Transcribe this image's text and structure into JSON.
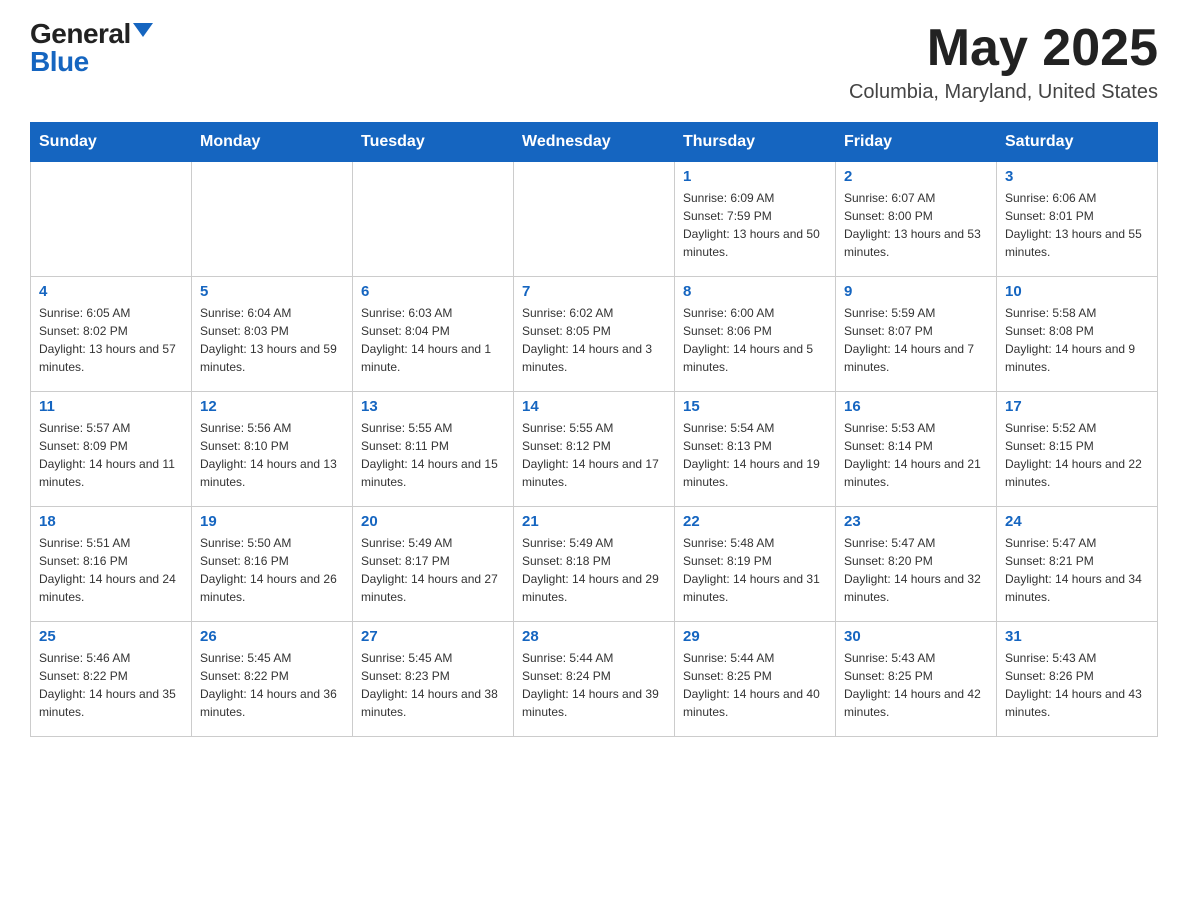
{
  "header": {
    "logo_general": "General",
    "logo_blue": "Blue",
    "month": "May 2025",
    "location": "Columbia, Maryland, United States"
  },
  "weekdays": [
    "Sunday",
    "Monday",
    "Tuesday",
    "Wednesday",
    "Thursday",
    "Friday",
    "Saturday"
  ],
  "weeks": [
    [
      {
        "day": "",
        "info": ""
      },
      {
        "day": "",
        "info": ""
      },
      {
        "day": "",
        "info": ""
      },
      {
        "day": "",
        "info": ""
      },
      {
        "day": "1",
        "info": "Sunrise: 6:09 AM\nSunset: 7:59 PM\nDaylight: 13 hours and 50 minutes."
      },
      {
        "day": "2",
        "info": "Sunrise: 6:07 AM\nSunset: 8:00 PM\nDaylight: 13 hours and 53 minutes."
      },
      {
        "day": "3",
        "info": "Sunrise: 6:06 AM\nSunset: 8:01 PM\nDaylight: 13 hours and 55 minutes."
      }
    ],
    [
      {
        "day": "4",
        "info": "Sunrise: 6:05 AM\nSunset: 8:02 PM\nDaylight: 13 hours and 57 minutes."
      },
      {
        "day": "5",
        "info": "Sunrise: 6:04 AM\nSunset: 8:03 PM\nDaylight: 13 hours and 59 minutes."
      },
      {
        "day": "6",
        "info": "Sunrise: 6:03 AM\nSunset: 8:04 PM\nDaylight: 14 hours and 1 minute."
      },
      {
        "day": "7",
        "info": "Sunrise: 6:02 AM\nSunset: 8:05 PM\nDaylight: 14 hours and 3 minutes."
      },
      {
        "day": "8",
        "info": "Sunrise: 6:00 AM\nSunset: 8:06 PM\nDaylight: 14 hours and 5 minutes."
      },
      {
        "day": "9",
        "info": "Sunrise: 5:59 AM\nSunset: 8:07 PM\nDaylight: 14 hours and 7 minutes."
      },
      {
        "day": "10",
        "info": "Sunrise: 5:58 AM\nSunset: 8:08 PM\nDaylight: 14 hours and 9 minutes."
      }
    ],
    [
      {
        "day": "11",
        "info": "Sunrise: 5:57 AM\nSunset: 8:09 PM\nDaylight: 14 hours and 11 minutes."
      },
      {
        "day": "12",
        "info": "Sunrise: 5:56 AM\nSunset: 8:10 PM\nDaylight: 14 hours and 13 minutes."
      },
      {
        "day": "13",
        "info": "Sunrise: 5:55 AM\nSunset: 8:11 PM\nDaylight: 14 hours and 15 minutes."
      },
      {
        "day": "14",
        "info": "Sunrise: 5:55 AM\nSunset: 8:12 PM\nDaylight: 14 hours and 17 minutes."
      },
      {
        "day": "15",
        "info": "Sunrise: 5:54 AM\nSunset: 8:13 PM\nDaylight: 14 hours and 19 minutes."
      },
      {
        "day": "16",
        "info": "Sunrise: 5:53 AM\nSunset: 8:14 PM\nDaylight: 14 hours and 21 minutes."
      },
      {
        "day": "17",
        "info": "Sunrise: 5:52 AM\nSunset: 8:15 PM\nDaylight: 14 hours and 22 minutes."
      }
    ],
    [
      {
        "day": "18",
        "info": "Sunrise: 5:51 AM\nSunset: 8:16 PM\nDaylight: 14 hours and 24 minutes."
      },
      {
        "day": "19",
        "info": "Sunrise: 5:50 AM\nSunset: 8:16 PM\nDaylight: 14 hours and 26 minutes."
      },
      {
        "day": "20",
        "info": "Sunrise: 5:49 AM\nSunset: 8:17 PM\nDaylight: 14 hours and 27 minutes."
      },
      {
        "day": "21",
        "info": "Sunrise: 5:49 AM\nSunset: 8:18 PM\nDaylight: 14 hours and 29 minutes."
      },
      {
        "day": "22",
        "info": "Sunrise: 5:48 AM\nSunset: 8:19 PM\nDaylight: 14 hours and 31 minutes."
      },
      {
        "day": "23",
        "info": "Sunrise: 5:47 AM\nSunset: 8:20 PM\nDaylight: 14 hours and 32 minutes."
      },
      {
        "day": "24",
        "info": "Sunrise: 5:47 AM\nSunset: 8:21 PM\nDaylight: 14 hours and 34 minutes."
      }
    ],
    [
      {
        "day": "25",
        "info": "Sunrise: 5:46 AM\nSunset: 8:22 PM\nDaylight: 14 hours and 35 minutes."
      },
      {
        "day": "26",
        "info": "Sunrise: 5:45 AM\nSunset: 8:22 PM\nDaylight: 14 hours and 36 minutes."
      },
      {
        "day": "27",
        "info": "Sunrise: 5:45 AM\nSunset: 8:23 PM\nDaylight: 14 hours and 38 minutes."
      },
      {
        "day": "28",
        "info": "Sunrise: 5:44 AM\nSunset: 8:24 PM\nDaylight: 14 hours and 39 minutes."
      },
      {
        "day": "29",
        "info": "Sunrise: 5:44 AM\nSunset: 8:25 PM\nDaylight: 14 hours and 40 minutes."
      },
      {
        "day": "30",
        "info": "Sunrise: 5:43 AM\nSunset: 8:25 PM\nDaylight: 14 hours and 42 minutes."
      },
      {
        "day": "31",
        "info": "Sunrise: 5:43 AM\nSunset: 8:26 PM\nDaylight: 14 hours and 43 minutes."
      }
    ]
  ]
}
